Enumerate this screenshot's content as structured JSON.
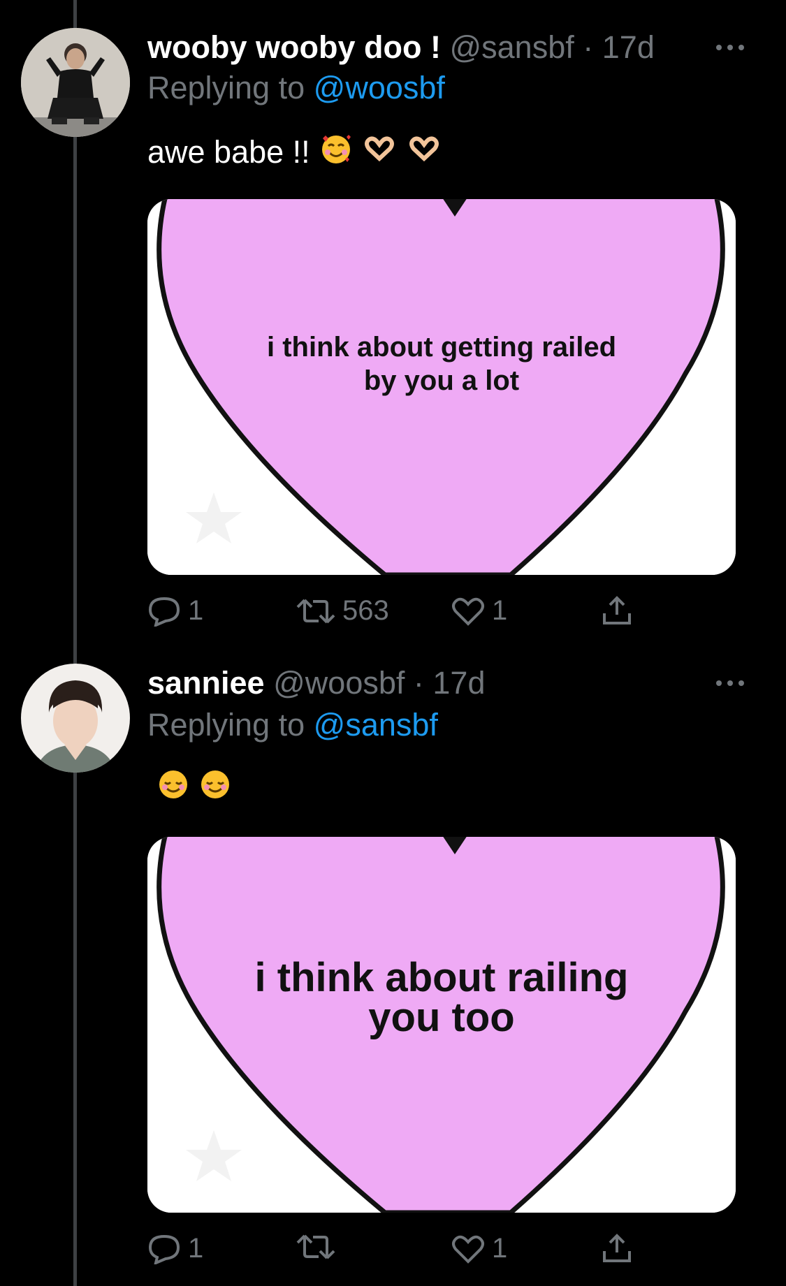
{
  "tweets": [
    {
      "display_name": "wooby wooby doo !",
      "handle": "@sansbf",
      "separator": "·",
      "time": "17d",
      "replying_prefix": "Replying to",
      "replying_handle": "@woosbf",
      "text": "awe babe !!",
      "emojis": [
        "smiling-face-with-hearts",
        "heart-hands",
        "heart-hands"
      ],
      "image_text_line1": "i think about getting railed",
      "image_text_line2": "by you a lot",
      "actions": {
        "replies": "1",
        "retweets": "563",
        "likes": "1"
      }
    },
    {
      "display_name": "sanniee",
      "handle": "@woosbf",
      "separator": "·",
      "time": "17d",
      "replying_prefix": "Replying to",
      "replying_handle": "@sansbf",
      "text": "",
      "emojis": [
        "smiling-face",
        "smiling-face"
      ],
      "image_text_line1": "i think about railing",
      "image_text_line2": "you too",
      "actions": {
        "replies": "1",
        "retweets": "",
        "likes": "1"
      }
    }
  ],
  "colors": {
    "background": "#000000",
    "secondary_text": "#71767b",
    "link": "#1d9bf0",
    "heart_fill": "#efaaf5",
    "thread_line": "#3e4144"
  }
}
